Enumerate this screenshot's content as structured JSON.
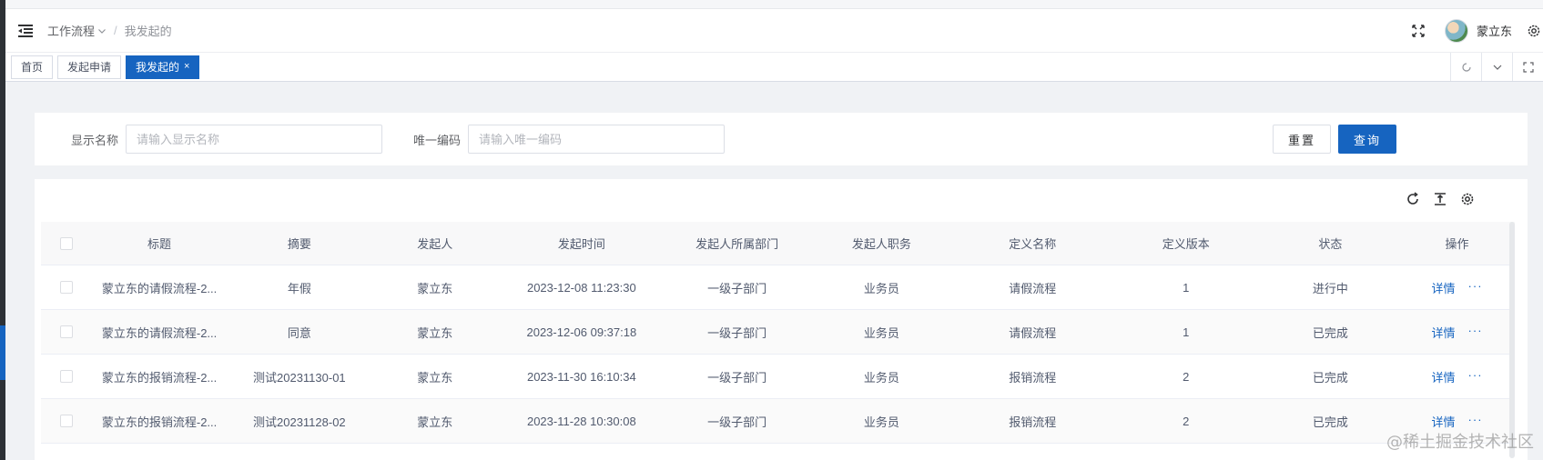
{
  "breadcrumb": {
    "parent": "工作流程",
    "current": "我发起的"
  },
  "user": {
    "name": "蒙立东"
  },
  "tags": [
    {
      "label": "首页",
      "active": false
    },
    {
      "label": "发起申请",
      "active": false
    },
    {
      "label": "我发起的",
      "active": true,
      "close": "×"
    }
  ],
  "search": {
    "name_label": "显示名称",
    "name_placeholder": "请输入显示名称",
    "code_label": "唯一编码",
    "code_placeholder": "请输入唯一编码",
    "reset_label": "重置",
    "query_label": "查询"
  },
  "table": {
    "columns": [
      "标题",
      "摘要",
      "发起人",
      "发起时间",
      "发起人所属部门",
      "发起人职务",
      "定义名称",
      "定义版本",
      "状态",
      "操作"
    ],
    "rows": [
      {
        "title": "蒙立东的请假流程-2...",
        "summary": "年假",
        "initiator": "蒙立东",
        "time": "2023-12-08 11:23:30",
        "dept": "一级子部门",
        "job": "业务员",
        "def_name": "请假流程",
        "version": "1",
        "status": "进行中",
        "detail": "详情",
        "more": "···"
      },
      {
        "title": "蒙立东的请假流程-2...",
        "summary": "同意",
        "initiator": "蒙立东",
        "time": "2023-12-06 09:37:18",
        "dept": "一级子部门",
        "job": "业务员",
        "def_name": "请假流程",
        "version": "1",
        "status": "已完成",
        "detail": "详情",
        "more": "···"
      },
      {
        "title": "蒙立东的报销流程-2...",
        "summary": "测试20231130-01",
        "initiator": "蒙立东",
        "time": "2023-11-30 16:10:34",
        "dept": "一级子部门",
        "job": "业务员",
        "def_name": "报销流程",
        "version": "2",
        "status": "已完成",
        "detail": "详情",
        "more": "···"
      },
      {
        "title": "蒙立东的报销流程-2...",
        "summary": "测试20231128-02",
        "initiator": "蒙立东",
        "time": "2023-11-28 10:30:08",
        "dept": "一级子部门",
        "job": "业务员",
        "def_name": "报销流程",
        "version": "2",
        "status": "已完成",
        "detail": "详情",
        "more": "···"
      }
    ]
  },
  "watermark": "@稀土掘金技术社区",
  "colors": {
    "primary": "#1664c0",
    "background": "#f0f2f5"
  },
  "icons": [
    "hamburger-icon",
    "chevron-down-icon",
    "fullscreen-icon",
    "avatar",
    "settings-icon",
    "refresh-icon",
    "collapse-icon",
    "column-settings-icon"
  ]
}
